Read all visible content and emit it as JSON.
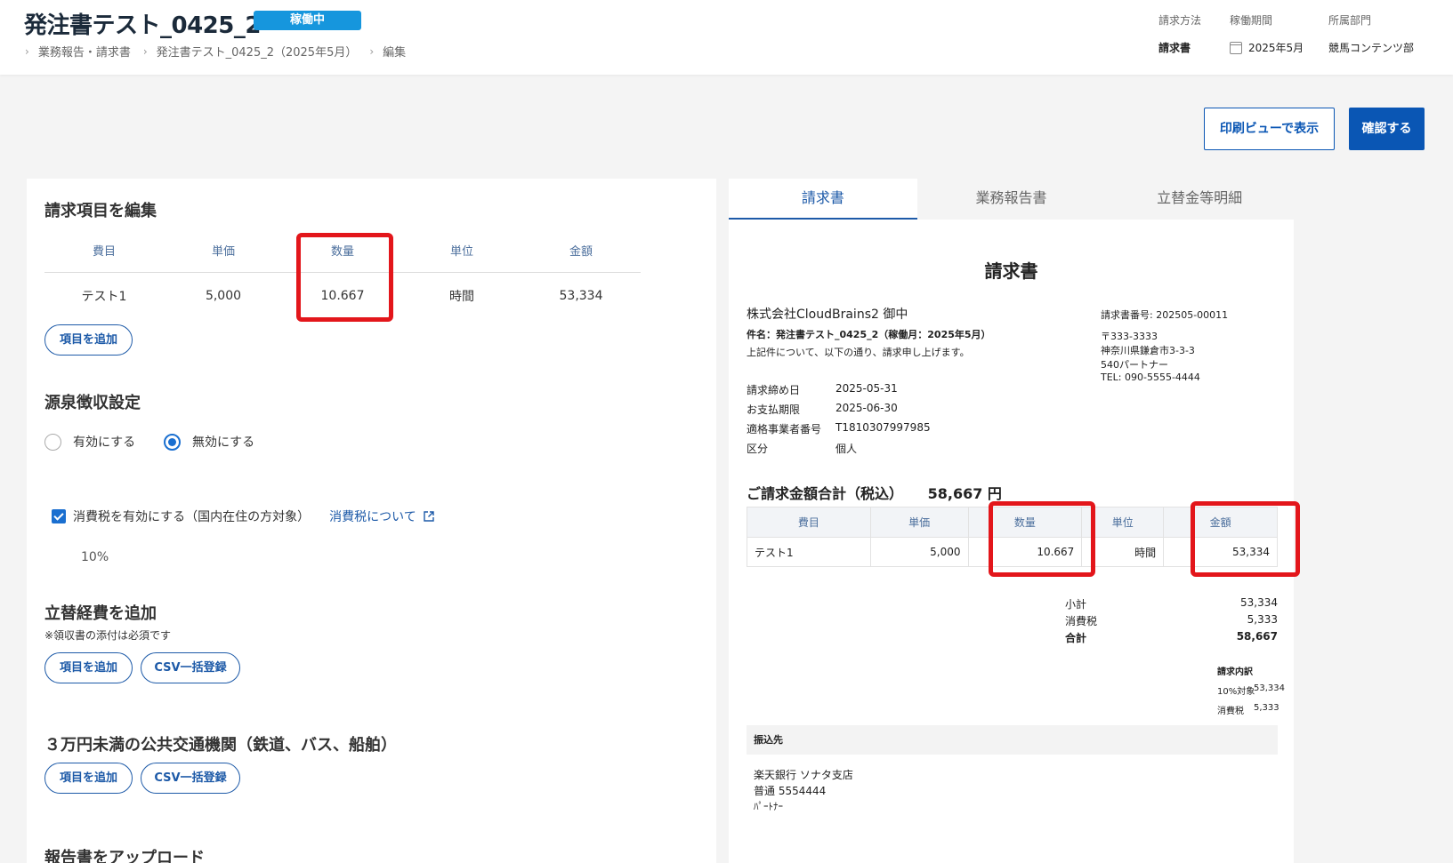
{
  "header": {
    "title": "発注書テスト_0425_2",
    "status_badge": "稼働中",
    "breadcrumb": [
      "業務報告・請求書",
      "発注書テスト_0425_2（2025年5月）",
      "編集"
    ],
    "meta": [
      {
        "label": "請求方法",
        "value": "請求書"
      },
      {
        "label": "稼働期間",
        "value": "2025年5月"
      },
      {
        "label": "所属部門",
        "value": "競馬コンテンツ部"
      }
    ]
  },
  "actions": {
    "print_view": "印刷ビューで表示",
    "confirm": "確認する"
  },
  "edit": {
    "section_title": "請求項目を編集",
    "columns": [
      "費目",
      "単価",
      "数量",
      "単位",
      "金額"
    ],
    "rows": [
      {
        "item": "テスト1",
        "unit_price": "5,000",
        "qty": "10.667",
        "unit": "時間",
        "amount": "53,334"
      }
    ],
    "add_item": "項目を追加"
  },
  "withholding": {
    "title": "源泉徴収設定",
    "options": [
      {
        "label": "有効にする",
        "selected": false
      },
      {
        "label": "無効にする",
        "selected": true
      }
    ]
  },
  "tax": {
    "checkbox_label": "消費税を有効にする（国内在住の方対象）",
    "checked": true,
    "link": "消費税について",
    "rate": "10%"
  },
  "expenses": {
    "title": "立替経費を追加",
    "note": "※領収書の添付は必須です",
    "add_item": "項目を追加",
    "csv": "CSV一括登録"
  },
  "transport": {
    "title": "３万円未満の公共交通機関（鉄道、バス、船舶）",
    "add_item": "項目を追加",
    "csv": "CSV一括登録"
  },
  "upload": {
    "title": "報告書をアップロード"
  },
  "tabs": [
    {
      "label": "請求書",
      "active": true
    },
    {
      "label": "業務報告書",
      "active": false
    },
    {
      "label": "立替金等明細",
      "active": false
    }
  ],
  "invoice": {
    "title": "請求書",
    "recipient": "株式会社CloudBrains2 御中",
    "subject": "件名：発注書テスト_0425_2（稼働月：2025年5月）",
    "intro": "上記件について、以下の通り、請求申し上げます。",
    "issuer": {
      "number": "請求書番号: 202505-00011",
      "postal": "〒333-3333",
      "address": "神奈川県鎌倉市3-3-3",
      "name": "540パートナー",
      "tel": "TEL: 090-5555-4444"
    },
    "fields": [
      {
        "label": "請求締め日",
        "value": "2025-05-31"
      },
      {
        "label": "お支払期限",
        "value": "2025-06-30"
      },
      {
        "label": "適格事業者番号",
        "value": "T1810307997985"
      },
      {
        "label": "区分",
        "value": "個人"
      }
    ],
    "total_label": "ご請求金額合計（税込）",
    "total_value": "58,667 円",
    "columns": [
      "費目",
      "単価",
      "数量",
      "単位",
      "金額"
    ],
    "rows": [
      {
        "item": "テスト1",
        "unit_price": "5,000",
        "qty": "10.667",
        "unit": "時間",
        "amount": "53,334"
      }
    ],
    "summary": [
      {
        "label": "小計",
        "value": "53,334"
      },
      {
        "label": "消費税",
        "value": "5,333"
      },
      {
        "label": "合計",
        "value": "58,667"
      }
    ],
    "breakdown_title": "請求内訳",
    "breakdown": [
      {
        "label": "10%対象",
        "value": "53,334"
      },
      {
        "label": "消費税",
        "value": "5,333"
      }
    ],
    "bank_title": "振込先",
    "bank": [
      "楽天銀行 ソナタ支店",
      "普通 5554444",
      "ﾊﾟｰﾄﾅｰ"
    ]
  }
}
